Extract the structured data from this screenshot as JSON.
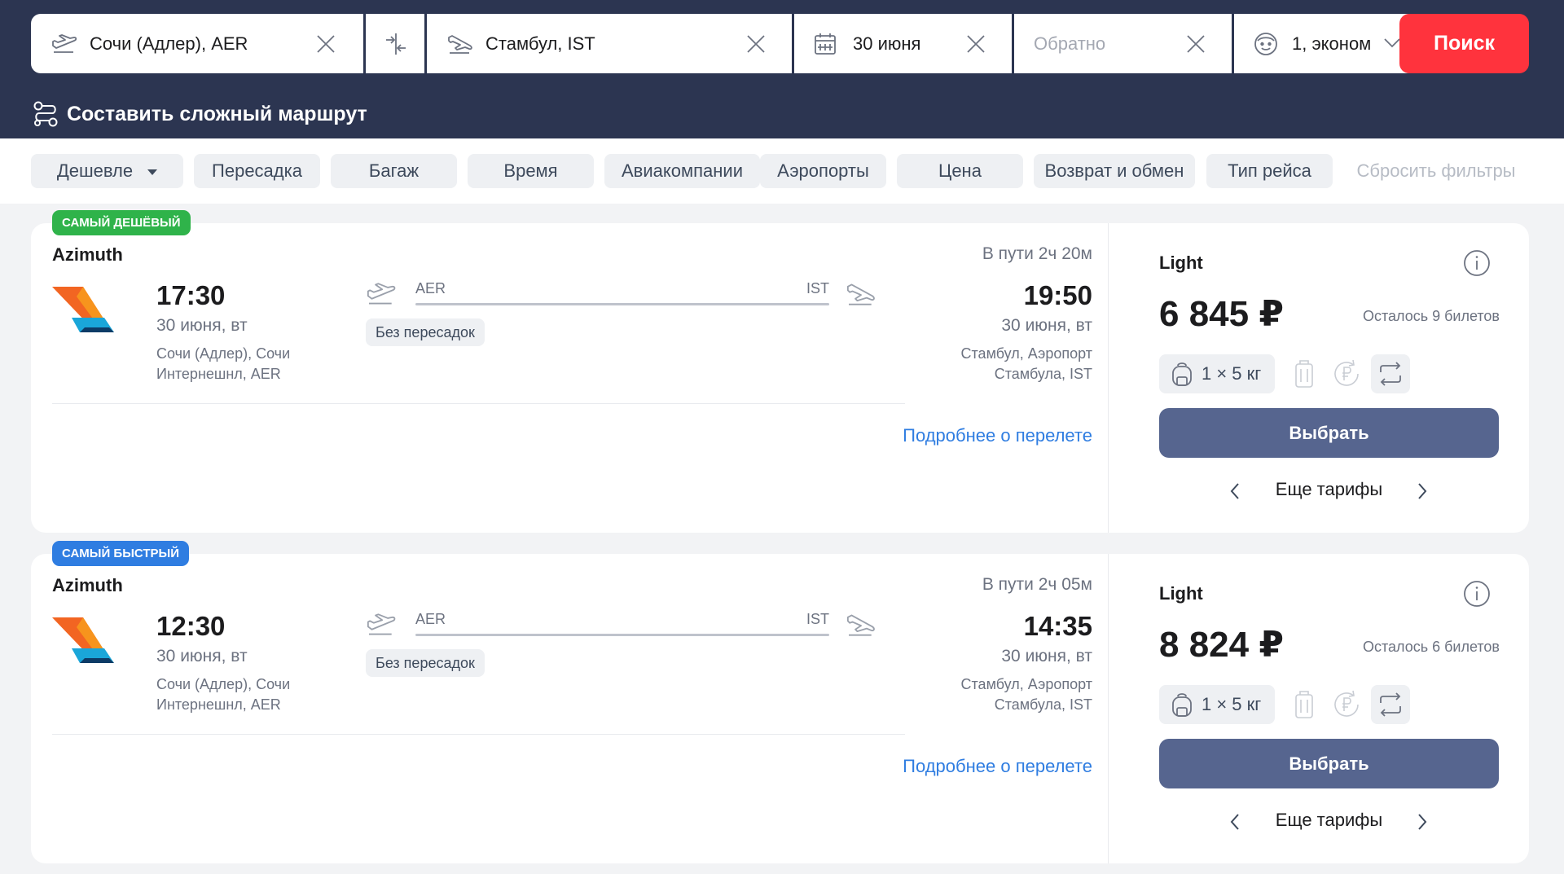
{
  "search": {
    "origin": "Сочи (Адлер), AER",
    "destination": "Стамбул, IST",
    "date": "30 июня",
    "return_placeholder": "Обратно",
    "passengers": "1, эконом",
    "search_label": "Поиск",
    "complex_route_label": "Составить сложный маршрут"
  },
  "filters": [
    {
      "label": "Дешевле"
    },
    {
      "label": "Пересадка"
    },
    {
      "label": "Багаж"
    },
    {
      "label": "Время"
    },
    {
      "label": "Авиакомпании"
    },
    {
      "label": "Аэропорты"
    },
    {
      "label": "Цена"
    },
    {
      "label": "Возврат и обмен"
    },
    {
      "label": "Тип рейса"
    },
    {
      "label": "Сбросить фильтры"
    }
  ],
  "flights": [
    {
      "badge": "САМЫЙ ДЕШЁВЫЙ",
      "badge_color": "#2fb34a",
      "airline": "Azimuth",
      "duration": "В пути 2ч 20м",
      "dep_time": "17:30",
      "dep_date": "30 июня, вт",
      "dep_airport": "Сочи (Адлер), Сочи Интернешнл, AER",
      "arr_time": "19:50",
      "arr_date": "30 июня, вт",
      "arr_airport": "Стамбул, Аэропорт Стамбула, IST",
      "from_code": "AER",
      "to_code": "IST",
      "stops": "Без пересадок",
      "details": "Подробнее о перелете",
      "tariff": "Light",
      "price": "6 845 ₽",
      "tickets_left": "Осталось 9 билетов",
      "baggage": "1 × 5 кг",
      "select_label": "Выбрать",
      "more_tariffs": "Еще тарифы"
    },
    {
      "badge": "САМЫЙ БЫСТРЫЙ",
      "badge_color": "#2f7de1",
      "airline": "Azimuth",
      "duration": "В пути 2ч 05м",
      "dep_time": "12:30",
      "dep_date": "30 июня, вт",
      "dep_airport": "Сочи (Адлер), Сочи Интернешнл, AER",
      "arr_time": "14:35",
      "arr_date": "30 июня, вт",
      "arr_airport": "Стамбул, Аэропорт Стамбула, IST",
      "from_code": "AER",
      "to_code": "IST",
      "stops": "Без пересадок",
      "details": "Подробнее о перелете",
      "tariff": "Light",
      "price": "8 824 ₽",
      "tickets_left": "Осталось 6 билетов",
      "baggage": "1 × 5 кг",
      "select_label": "Выбрать",
      "more_tariffs": "Еще тарифы"
    }
  ],
  "colors": {
    "header_bg": "#2c3551",
    "search_button": "#ff333d",
    "select_button": "#56658f",
    "link": "#2f7de1"
  },
  "icons": {
    "origin": "plane-takeoff-icon",
    "swap": "swap-arrows-icon",
    "destination": "plane-landing-icon",
    "date": "calendar-icon",
    "clear": "close-icon",
    "passenger": "passenger-face-icon",
    "dropdown": "chevron-down-icon",
    "complex_route": "route-icon",
    "info": "info-icon",
    "baggage": "backpack-icon",
    "luggage": "suitcase-icon",
    "refund": "refund-icon",
    "exchange": "exchange-icon"
  }
}
